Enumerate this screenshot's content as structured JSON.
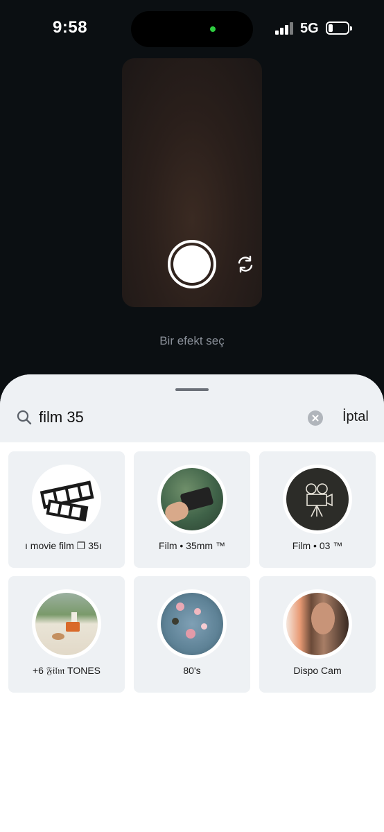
{
  "status_bar": {
    "time": "9:58",
    "network": "5G"
  },
  "camera": {
    "hint": "Bir efekt seç"
  },
  "search": {
    "query": "film 35",
    "cancel_label": "İptal"
  },
  "effects": [
    {
      "label": "ı movie film ❐ 35ı"
    },
    {
      "label": "Film • 35mm ™"
    },
    {
      "label": "Film • 03 ™"
    },
    {
      "label": "+6 𝔉𝔦𝔩𝔪 TONES"
    },
    {
      "label": "80's"
    },
    {
      "label": "Dispo Cam"
    }
  ]
}
